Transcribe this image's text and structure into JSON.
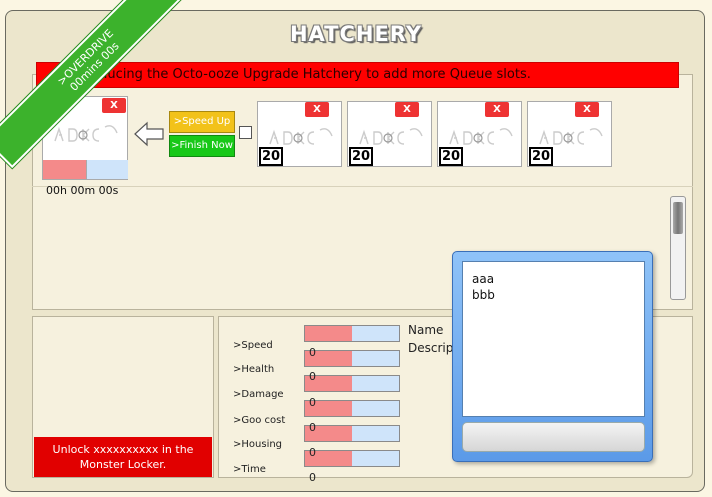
{
  "title": "HATCHERY",
  "ribbon": {
    "line1": ">OVERDRIVE",
    "line2": "00mins 00s"
  },
  "banner": "Introducing the Octo-ooze Upgrade Hatchery to add more Queue slots.",
  "active_slot": {
    "close_label": "X",
    "timer": "00h 00m 00s"
  },
  "buttons": {
    "speed_up": ">Speed Up",
    "finish_now": ">Finish Now"
  },
  "queue_slots": [
    {
      "close_label": "X",
      "count": "20"
    },
    {
      "close_label": "X",
      "count": "20"
    },
    {
      "close_label": "X",
      "count": "20"
    },
    {
      "close_label": "X",
      "count": "20"
    }
  ],
  "unlock_text": "Unlock xxxxxxxxxx in the Monster Locker.",
  "stats": [
    {
      "label": ">Speed",
      "value": "0",
      "fill": 0.5
    },
    {
      "label": ">Health",
      "value": "0",
      "fill": 0.5
    },
    {
      "label": ">Damage",
      "value": "0",
      "fill": 0.5
    },
    {
      "label": ">Goo cost",
      "value": "0",
      "fill": 0.5
    },
    {
      "label": ">Housing",
      "value": "0",
      "fill": 0.5
    },
    {
      "label": ">Time",
      "value": "0",
      "fill": 0.5
    }
  ],
  "info": {
    "name": "Name",
    "description": "Descrip"
  },
  "popup": {
    "line1": "aaa",
    "line2": "bbb",
    "button_label": ""
  },
  "colors": {
    "banner": "#ff0000",
    "speed_up": "#f2c21a",
    "finish_now": "#18c818",
    "ribbon": "#3cb22c"
  }
}
